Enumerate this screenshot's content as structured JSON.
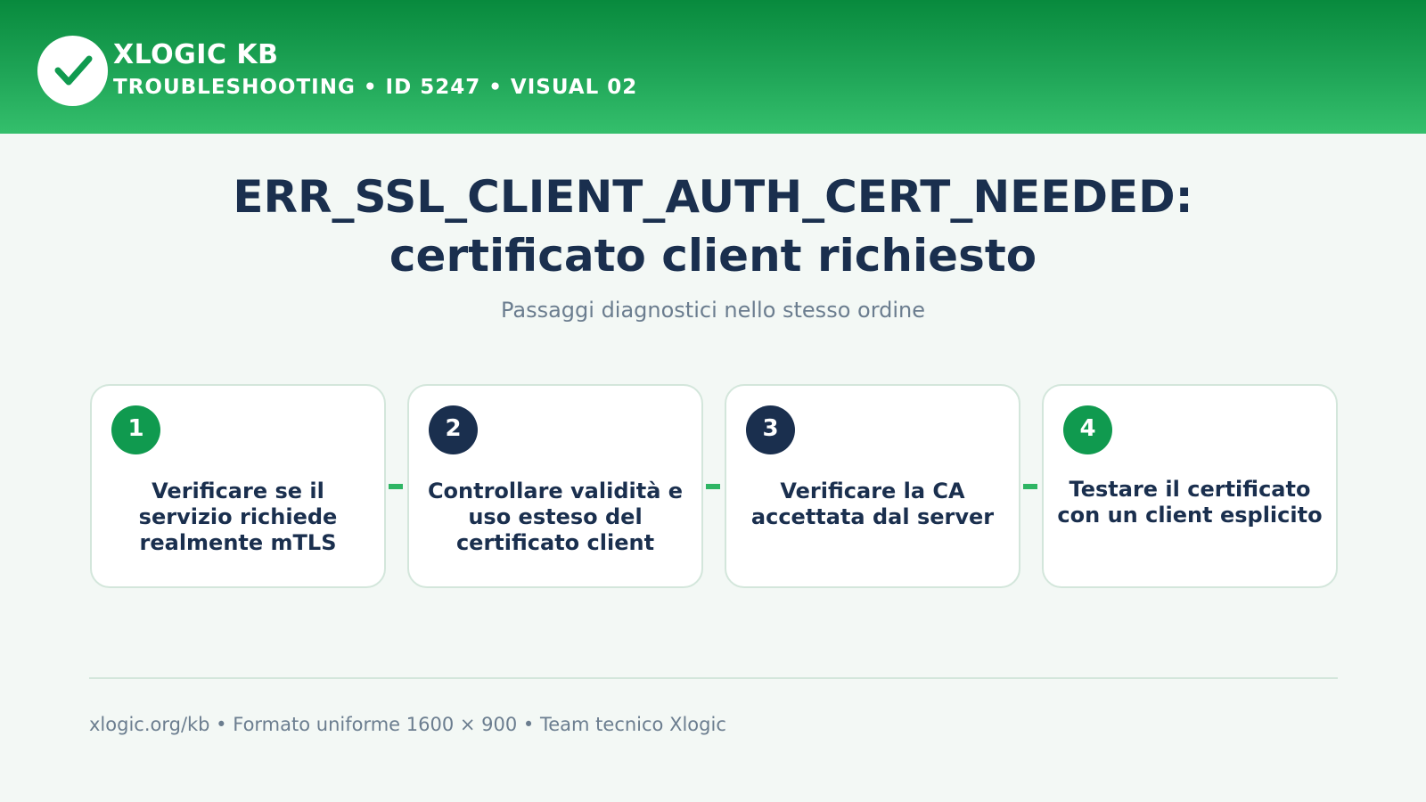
{
  "header": {
    "brand": "XLOGIC KB",
    "subtitle": "TROUBLESHOOTING • ID 5247 • VISUAL 02",
    "logo_icon": "checkmark-icon",
    "gradient_colors": [
      "#088a3d",
      "#34bf6c"
    ]
  },
  "main": {
    "title_line1": "ERR_SSL_CLIENT_AUTH_CERT_NEEDED:",
    "title_line2": "certificato client richiesto",
    "subtitle": "Passaggi diagnostici nello stesso ordine"
  },
  "steps": [
    {
      "number": "1",
      "text": "Verificare se il servizio richiede realmente mTLS",
      "badge_color": "#109a4f"
    },
    {
      "number": "2",
      "text": "Controllare validità e uso esteso del certificato client",
      "badge_color": "#1a2f4e"
    },
    {
      "number": "3",
      "text": "Verificare la CA accettata dal server",
      "badge_color": "#1a2f4e"
    },
    {
      "number": "4",
      "text": "Testare il certificato con un client esplicito",
      "badge_color": "#109a4f"
    }
  ],
  "footer": {
    "text": "xlogic.org/kb • Formato uniforme 1600 × 900 • Team tecnico Xlogic"
  },
  "colors": {
    "navy": "#1a2f4e",
    "green": "#109a4f",
    "accent": "#2fb564",
    "muted_text": "#6b7d8f",
    "background": "#f3f8f5"
  }
}
